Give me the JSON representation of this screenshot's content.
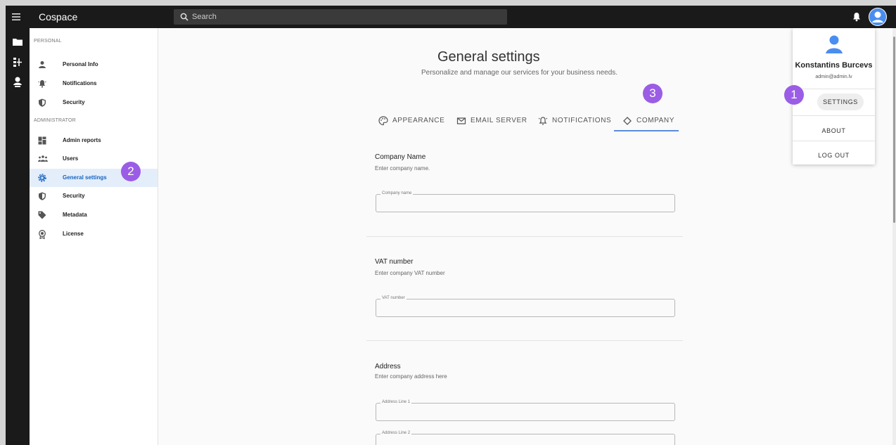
{
  "app": {
    "title": "Cospace"
  },
  "search": {
    "placeholder": "Search"
  },
  "sidebar": {
    "personal_label": "PERSONAL",
    "admin_label": "ADMINISTRATOR",
    "personal_items": [
      {
        "label": "Personal Info",
        "icon": "person-icon"
      },
      {
        "label": "Notifications",
        "icon": "bell-ring-icon"
      },
      {
        "label": "Security",
        "icon": "shield-icon"
      }
    ],
    "admin_items": [
      {
        "label": "Admin reports",
        "icon": "dashboard-icon"
      },
      {
        "label": "Users",
        "icon": "users-icon"
      },
      {
        "label": "General settings",
        "icon": "gear-icon",
        "active": true
      },
      {
        "label": "Security",
        "icon": "shield-icon"
      },
      {
        "label": "Metadata",
        "icon": "tag-icon"
      },
      {
        "label": "License",
        "icon": "certificate-icon"
      }
    ]
  },
  "main": {
    "title": "General settings",
    "subtitle": "Personalize and manage our services for your business needs.",
    "tabs": [
      {
        "label": "APPEARANCE",
        "icon": "palette-icon"
      },
      {
        "label": "EMAIL SERVER",
        "icon": "email-icon"
      },
      {
        "label": "NOTIFICATIONS",
        "icon": "bell-icon"
      },
      {
        "label": "COMPANY",
        "icon": "diamond-icon",
        "active": true
      }
    ],
    "company_name": {
      "title": "Company Name",
      "desc": "Enter company name.",
      "legend": "Company name",
      "value": ""
    },
    "vat": {
      "title": "VAT number",
      "desc": "Enter company VAT number",
      "legend": "VAT number",
      "value": ""
    },
    "address": {
      "title": "Address",
      "desc": "Enter company address here",
      "line1_legend": "Address Line 1",
      "line2_legend": "Address Line 2"
    }
  },
  "user_menu": {
    "name": "Konstantins Burcevs",
    "email": "admin@admin.lv",
    "settings_label": "SETTINGS",
    "about_label": "ABOUT",
    "logout_label": "LOG OUT"
  },
  "badges": {
    "one": "1",
    "two": "2",
    "three": "3"
  },
  "colors": {
    "accent": "#1565c0",
    "badge": "#9b5de5",
    "topbar": "#1a1a1a",
    "avatar": "#4a8df0"
  }
}
